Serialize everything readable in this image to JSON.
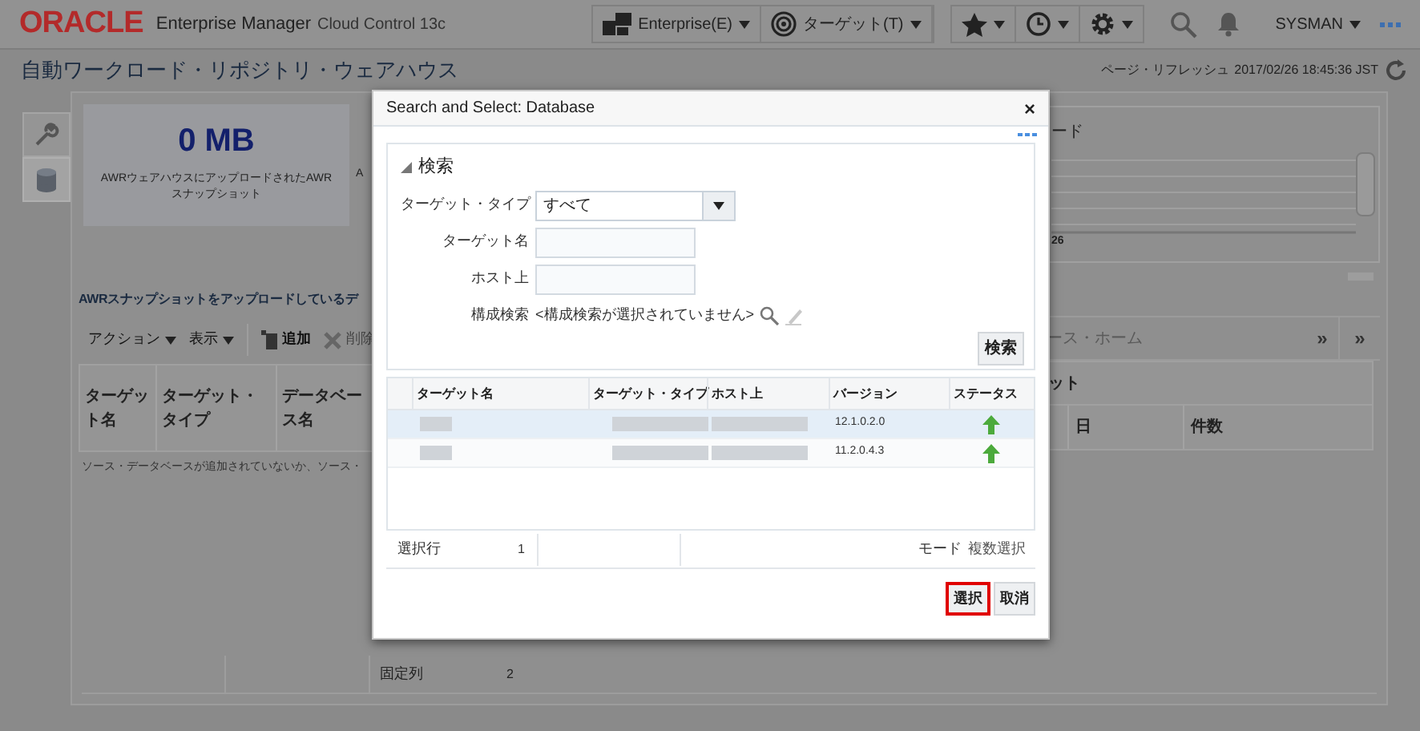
{
  "header": {
    "logo": "ORACLE",
    "product": "Enterprise Manager",
    "edition": "Cloud Control 13c",
    "menus": [
      {
        "label": "Enterprise(E)",
        "kind": "blocks"
      },
      {
        "label": "ターゲット(T)",
        "kind": "target"
      }
    ],
    "user": "SYSMAN"
  },
  "page": {
    "title": "自動ワークロード・リポジトリ・ウェアハウス",
    "refresh_label": "ページ・リフレッシュ",
    "refresh_time": "2017/02/26 18:45:36 JST"
  },
  "side_tabs": [
    {
      "kind": "wrench",
      "selected": false
    },
    {
      "kind": "database",
      "selected": true
    }
  ],
  "summary_card": {
    "value": "0 MB",
    "caption_1": "AWRウェアハウスにアップロードされたAWR",
    "caption_2": "スナップショット",
    "second_caption": "A"
  },
  "section_title": "AWRスナップショットをアップロードしているデ",
  "toolbar": [
    {
      "label": "アクション",
      "kind": "menu",
      "disabled": false
    },
    {
      "label": "表示",
      "kind": "menu",
      "disabled": false
    },
    {
      "label": "追加",
      "kind": "add",
      "disabled": false
    },
    {
      "label": "削除",
      "kind": "delete",
      "disabled": true
    }
  ],
  "main_table": {
    "columns": [
      "ターゲット名",
      "ターゲット・タイプ",
      "データベース名"
    ],
    "empty_message": "ソース・データベースが追加されていないか、ソース・"
  },
  "right_panel": {
    "title": "ード",
    "axis_label": "26",
    "tab_label": "ース・ホーム",
    "tab_more": "»",
    "panel_more": "»",
    "table_group": "ット",
    "columns": [
      "日",
      "件数"
    ]
  },
  "footer": {
    "label": "固定列",
    "value": "2"
  },
  "dialog": {
    "title": "Search and Select: Database",
    "close": "×",
    "search": {
      "title": "検索",
      "expanded": true,
      "fields": [
        {
          "kind": "select",
          "label": "ターゲット・タイプ",
          "value": "すべて"
        },
        {
          "kind": "text",
          "label": "ターゲット名"
        },
        {
          "kind": "text",
          "label": "ホスト上"
        },
        {
          "kind": "config",
          "label": "構成検索",
          "value": "<構成検索が選択されていません>"
        }
      ],
      "button": "検索"
    },
    "table": {
      "columns": [
        "ターゲット名",
        "ターゲット・タイプ",
        "ホスト上",
        "バージョン",
        "ステータス"
      ],
      "rows": [
        {
          "selected": true,
          "version": "12.1.0.2.0",
          "up": true
        },
        {
          "selected": false,
          "version": "11.2.0.4.3",
          "up": true
        }
      ]
    },
    "selected_rows_label": "選択行",
    "selected_rows_value": "1",
    "mode_label": "モード",
    "mode_value": "複数選択",
    "buttons": [
      {
        "label": "選択",
        "highlighted": true
      },
      {
        "label": "取消",
        "highlighted": false
      }
    ]
  }
}
